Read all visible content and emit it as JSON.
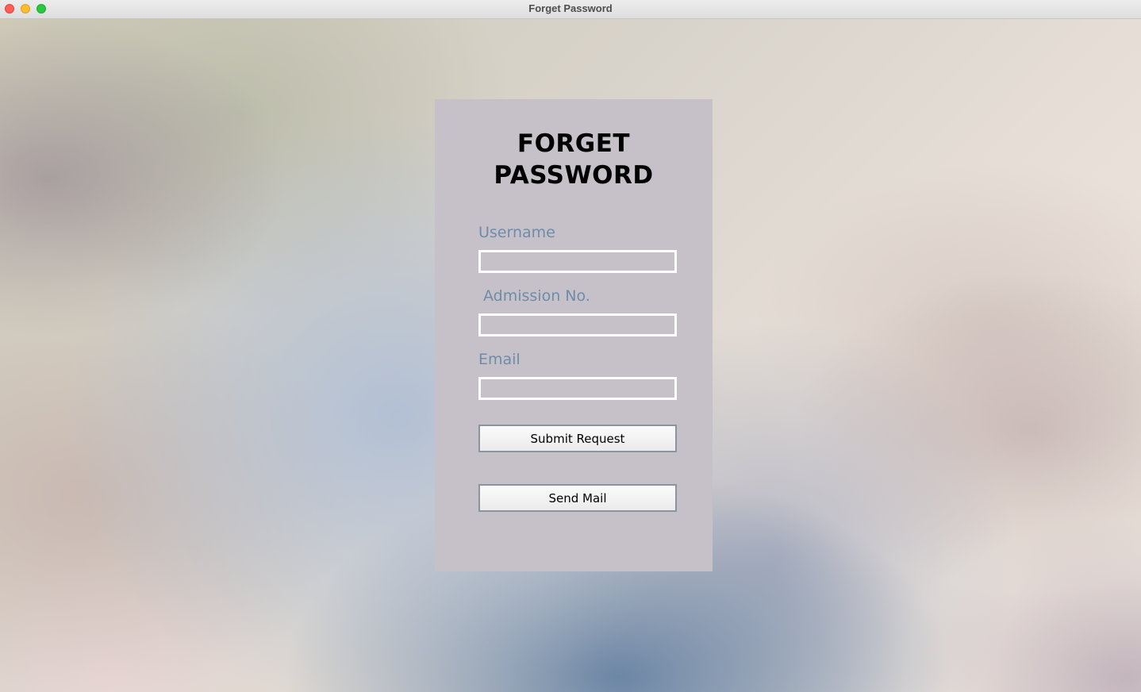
{
  "window": {
    "title": "Forget Password"
  },
  "form": {
    "heading": "FORGET PASSWORD",
    "fields": [
      {
        "label": "Username",
        "value": ""
      },
      {
        "label": "Admission No.",
        "value": ""
      },
      {
        "label": "Email",
        "value": ""
      }
    ],
    "submit_label": "Submit Request",
    "send_mail_label": "Send Mail"
  },
  "colors": {
    "panel_background": "#c6c1c8",
    "label_color": "#6f8ca8",
    "heading_color": "#000000",
    "input_border": "#ffffff"
  }
}
